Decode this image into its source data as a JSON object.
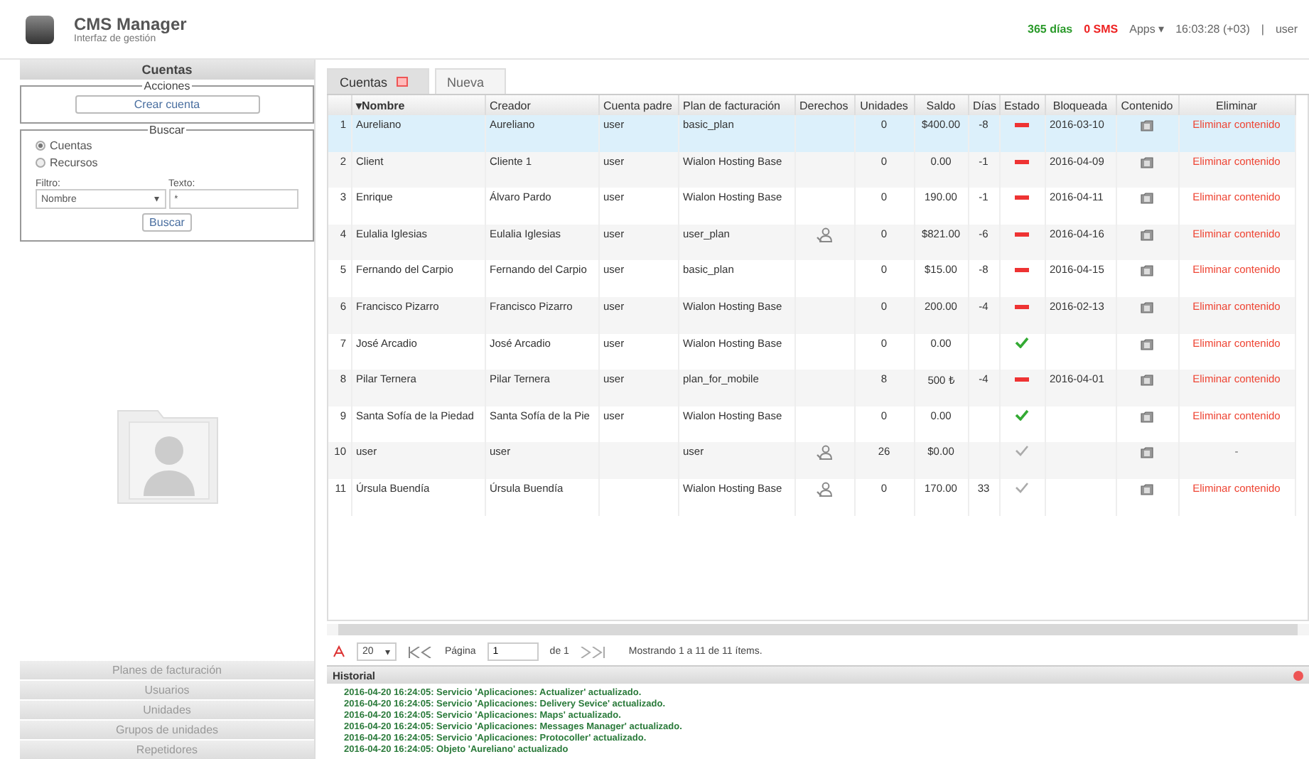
{
  "header": {
    "title": "CMS Manager",
    "subtitle": "Interfaz de gestión",
    "days": "365 días",
    "sms": "0 SMS",
    "apps": "Apps",
    "apps_caret": "▾",
    "time": "16:03:28 (+03)",
    "separator": "|",
    "user": "user"
  },
  "sidebar": {
    "title": "Cuentas",
    "actions": {
      "legend": "Acciones",
      "button": "Crear cuenta"
    },
    "search": {
      "legend": "Buscar",
      "options": [
        {
          "label": "Cuentas",
          "selected": true
        },
        {
          "label": "Recursos",
          "selected": false
        }
      ],
      "filter_label": "Filtro:",
      "filter_value": "Nombre",
      "filter_caret": "▾",
      "text_label": "Texto:",
      "text_value": "*",
      "button": "Buscar"
    },
    "sections": [
      "Planes de facturación",
      "Usuarios",
      "Unidades",
      "Grupos de unidades",
      "Repetidores"
    ]
  },
  "tabs": [
    {
      "label": "Cuentas",
      "selected": true,
      "closable": true
    },
    {
      "label": "Nueva",
      "selected": false,
      "closable": false
    }
  ],
  "table": {
    "columns": [
      "",
      "▾Nombre",
      "Creador",
      "Cuenta padre",
      "Plan de facturación",
      "Derechos",
      "Unidades",
      "Saldo",
      "Días",
      "Estado",
      "Bloqueada",
      "Contenido",
      "Eliminar"
    ],
    "rows": [
      {
        "n": "1",
        "name": "Aureliano",
        "creator": "Aureliano",
        "parent": "user",
        "plan": "basic_plan",
        "rights": false,
        "units": "0",
        "balance": "$400.00",
        "days": "-8",
        "status": {
          "kind": "blocked"
        },
        "blocked": "2016-03-10",
        "delete": "Eliminar contenido",
        "selected": true
      },
      {
        "n": "2",
        "name": "Client",
        "creator": "Cliente 1",
        "parent": "user",
        "plan": "Wialon Hosting Base",
        "rights": false,
        "units": "0",
        "balance": "0.00",
        "days": "-1",
        "status": {
          "kind": "blocked"
        },
        "blocked": "2016-04-09",
        "delete": "Eliminar contenido",
        "selected": false
      },
      {
        "n": "3",
        "name": "Enrique",
        "creator": "Álvaro Pardo",
        "parent": "user",
        "plan": "Wialon Hosting Base",
        "rights": false,
        "units": "0",
        "balance": "190.00",
        "days": "-1",
        "status": {
          "kind": "blocked"
        },
        "blocked": "2016-04-11",
        "delete": "Eliminar contenido",
        "selected": false
      },
      {
        "n": "4",
        "name": "Eulalia Iglesias",
        "creator": "Eulalia Iglesias",
        "parent": "user",
        "plan": "user_plan",
        "rights": true,
        "units": "0",
        "balance": "$821.00",
        "days": "-6",
        "status": {
          "kind": "blocked"
        },
        "blocked": "2016-04-16",
        "delete": "Eliminar contenido",
        "selected": false
      },
      {
        "n": "5",
        "name": "Fernando del Carpio",
        "creator": "Fernando del Carpio",
        "parent": "user",
        "plan": "basic_plan",
        "rights": false,
        "units": "0",
        "balance": "$15.00",
        "days": "-8",
        "status": {
          "kind": "blocked"
        },
        "blocked": "2016-04-15",
        "delete": "Eliminar contenido",
        "selected": false
      },
      {
        "n": "6",
        "name": "Francisco Pizarro",
        "creator": "Francisco Pizarro",
        "parent": "user",
        "plan": "Wialon Hosting Base",
        "rights": false,
        "units": "0",
        "balance": "200.00",
        "days": "-4",
        "status": {
          "kind": "blocked"
        },
        "blocked": "2016-02-13",
        "delete": "Eliminar contenido",
        "selected": false
      },
      {
        "n": "7",
        "name": "José Arcadio",
        "creator": "José Arcadio",
        "parent": "user",
        "plan": "Wialon Hosting Base",
        "rights": false,
        "units": "0",
        "balance": "0.00",
        "days": "",
        "status": {
          "kind": "active"
        },
        "blocked": "",
        "delete": "Eliminar contenido",
        "selected": false
      },
      {
        "n": "8",
        "name": "Pilar Ternera",
        "creator": "Pilar Ternera",
        "parent": "user",
        "plan": "plan_for_mobile",
        "rights": false,
        "units": "8",
        "balance": "500 ₺",
        "days": "-4",
        "status": {
          "kind": "blocked"
        },
        "blocked": "2016-04-01",
        "delete": "Eliminar contenido",
        "selected": false
      },
      {
        "n": "9",
        "name": "Santa Sofía de la Piedad",
        "creator": "Santa Sofía de la Pie",
        "parent": "user",
        "plan": "Wialon Hosting Base",
        "rights": false,
        "units": "0",
        "balance": "0.00",
        "days": "",
        "status": {
          "kind": "active"
        },
        "blocked": "",
        "delete": "Eliminar contenido",
        "selected": false
      },
      {
        "n": "10",
        "name": "user",
        "creator": "user",
        "parent": "",
        "plan": "user",
        "rights": true,
        "units": "26",
        "balance": "$0.00",
        "days": "",
        "status": {
          "kind": "inactive"
        },
        "blocked": "",
        "delete": "-",
        "selected": false
      },
      {
        "n": "11",
        "name": "Úrsula Buendía",
        "creator": "Úrsula Buendía",
        "parent": "",
        "plan": "Wialon Hosting Base",
        "rights": true,
        "units": "0",
        "balance": "170.00",
        "days": "33",
        "status": {
          "kind": "inactive"
        },
        "blocked": "",
        "delete": "Eliminar contenido",
        "selected": false
      }
    ]
  },
  "pager": {
    "page_size": "20",
    "page_size_caret": "▾",
    "page_label": "Página",
    "page": "1",
    "of": "de 1",
    "summary": "Mostrando 1 a 11 de 11 ítems."
  },
  "history": {
    "title": "Historial",
    "lines": [
      "2016-04-20 16:24:05: Servicio 'Aplicaciones: Actualizer' actualizado.",
      "2016-04-20 16:24:05: Servicio 'Aplicaciones: Delivery Sevice' actualizado.",
      "2016-04-20 16:24:05: Servicio 'Aplicaciones: Maps' actualizado.",
      "2016-04-20 16:24:05: Servicio 'Aplicaciones: Messages Manager' actualizado.",
      "2016-04-20 16:24:05: Servicio 'Aplicaciones: Protocoller' actualizado.",
      "2016-04-20 16:24:05: Objeto 'Aureliano' actualizado"
    ]
  }
}
